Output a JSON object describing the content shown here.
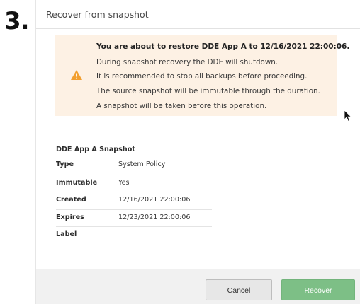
{
  "step": {
    "number": "3."
  },
  "dialog": {
    "title": "Recover from snapshot",
    "warning": {
      "icon": "warning-triangle-icon",
      "color": "#f29f2e",
      "heading": "You are about to restore DDE App A to 12/16/2021 22:00:06.",
      "lines": [
        "During snapshot recovery the DDE will shutdown.",
        "It is recommended to stop all backups before proceeding.",
        "The source snapshot will be immutable through the duration.",
        "A snapshot will be taken before this operation."
      ]
    },
    "details": {
      "title": "DDE App A Snapshot",
      "rows": [
        {
          "label": "Type",
          "value": "System Policy"
        },
        {
          "label": "Immutable",
          "value": "Yes"
        },
        {
          "label": "Created",
          "value": "12/16/2021 22:00:06"
        },
        {
          "label": "Expires",
          "value": "12/23/2021 22:00:06"
        },
        {
          "label": "Label",
          "value": ""
        }
      ]
    },
    "buttons": {
      "cancel": "Cancel",
      "recover": "Recover"
    }
  }
}
